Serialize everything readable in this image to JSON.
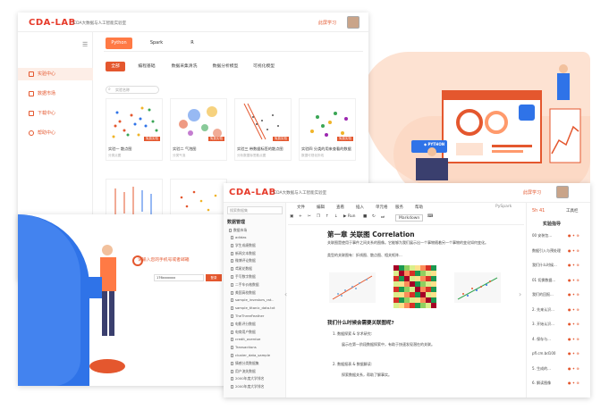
{
  "brand": {
    "logo": "CDA-LAB",
    "tagline": "CDA大数据与人工智能实验室",
    "login": "此屏学习"
  },
  "window_main": {
    "sidebar": [
      {
        "label": "实验中心",
        "active": true
      },
      {
        "label": "数据市场",
        "active": false
      },
      {
        "label": "下载中心",
        "active": false
      },
      {
        "label": "帮助中心",
        "active": false
      }
    ],
    "languages": [
      "Python",
      "Spark",
      "R"
    ],
    "categories": [
      "全部",
      "编程基础",
      "数据采集清洗",
      "数据分析模型",
      "可视化模型"
    ],
    "search_placeholder": "实验名称",
    "cards": [
      {
        "name": "实验一 散点图",
        "sub": "分类点图",
        "tag": "免费实验"
      },
      {
        "name": "实验二 气泡图",
        "sub": "分类气泡",
        "tag": "免费实验"
      },
      {
        "name": "实验三 带数据标签的散点图",
        "sub": "分析数据标签散点图",
        "tag": "免费实验"
      },
      {
        "name": "实验四 分类的用来查看的数据",
        "sub": "数据可视化折线",
        "tag": "免费实验"
      },
      {
        "name": "",
        "sub": "",
        "tag": "免费实验"
      },
      {
        "name": "",
        "sub": "",
        "tag": "免费实验"
      }
    ]
  },
  "window_notebook": {
    "file_search": "搜索数据集",
    "file_header": "数据管理",
    "file_root": "数据市场",
    "files": [
      "adidas",
      "学生成绩数据",
      "新闻文本数据",
      "微博评论数据",
      "鸢尾花数据",
      "手写数字数据",
      "二手车价格数据",
      "美国高校数据",
      "sample_investors_rat..",
      "sample_titanic_data.txt",
      "TheThreeFeather",
      "电影评分数据",
      "电商用户数据",
      "credit_overdue",
      "Transactions",
      "cluster_data_sample",
      "情感分类数据集",
      "用户流失数据",
      "2000年度大学排名",
      "2000年度大学排名"
    ],
    "menu": [
      "文件",
      "编辑",
      "查看",
      "插入",
      "单元格",
      "服务",
      "帮助"
    ],
    "kernel": "PySpark",
    "run_label": "Run",
    "cell_type": "Markdown",
    "title": "第一章 关联图 Correlation",
    "paragraphs": [
      "关联图是使用于事件之间关系的图像。它能够为我们展示出一个事物随着另一个事物的变化如何变化。",
      "类型的关联图有：折线图、散点图、相关矩阵..."
    ],
    "section": "我们什么时候会需要关联图呢?",
    "bullets": [
      "1. 数据探索 & 学术研究:",
      "展示在第一阶段数据探索中，有助于快速发现潜在的关联。",
      "2. 数据报表 & 数据解读:",
      "探索数据关系，帮助了解事实。"
    ]
  },
  "guide": {
    "counter": "5h 41",
    "tool": "工具栏",
    "title": "实验指导",
    "items": [
      "00 安装包...",
      "数据引入与预处理",
      "我们什么时候...",
      "01 切换数据...",
      "我们的回报...",
      "2. 先来认识...",
      "3. 开始认识...",
      "4. 保存与...",
      "pfl.cm.bd100",
      "5. 生成的...",
      "6. 解读图像"
    ]
  },
  "login_window": {
    "prompt": "请输入您的手机号或者邮箱",
    "input_value": "176xxxxxxx",
    "submit": "登录"
  },
  "colors": {
    "brand": "#e4572e",
    "accent": "#ff7a45",
    "blue": "#2f73e8"
  }
}
